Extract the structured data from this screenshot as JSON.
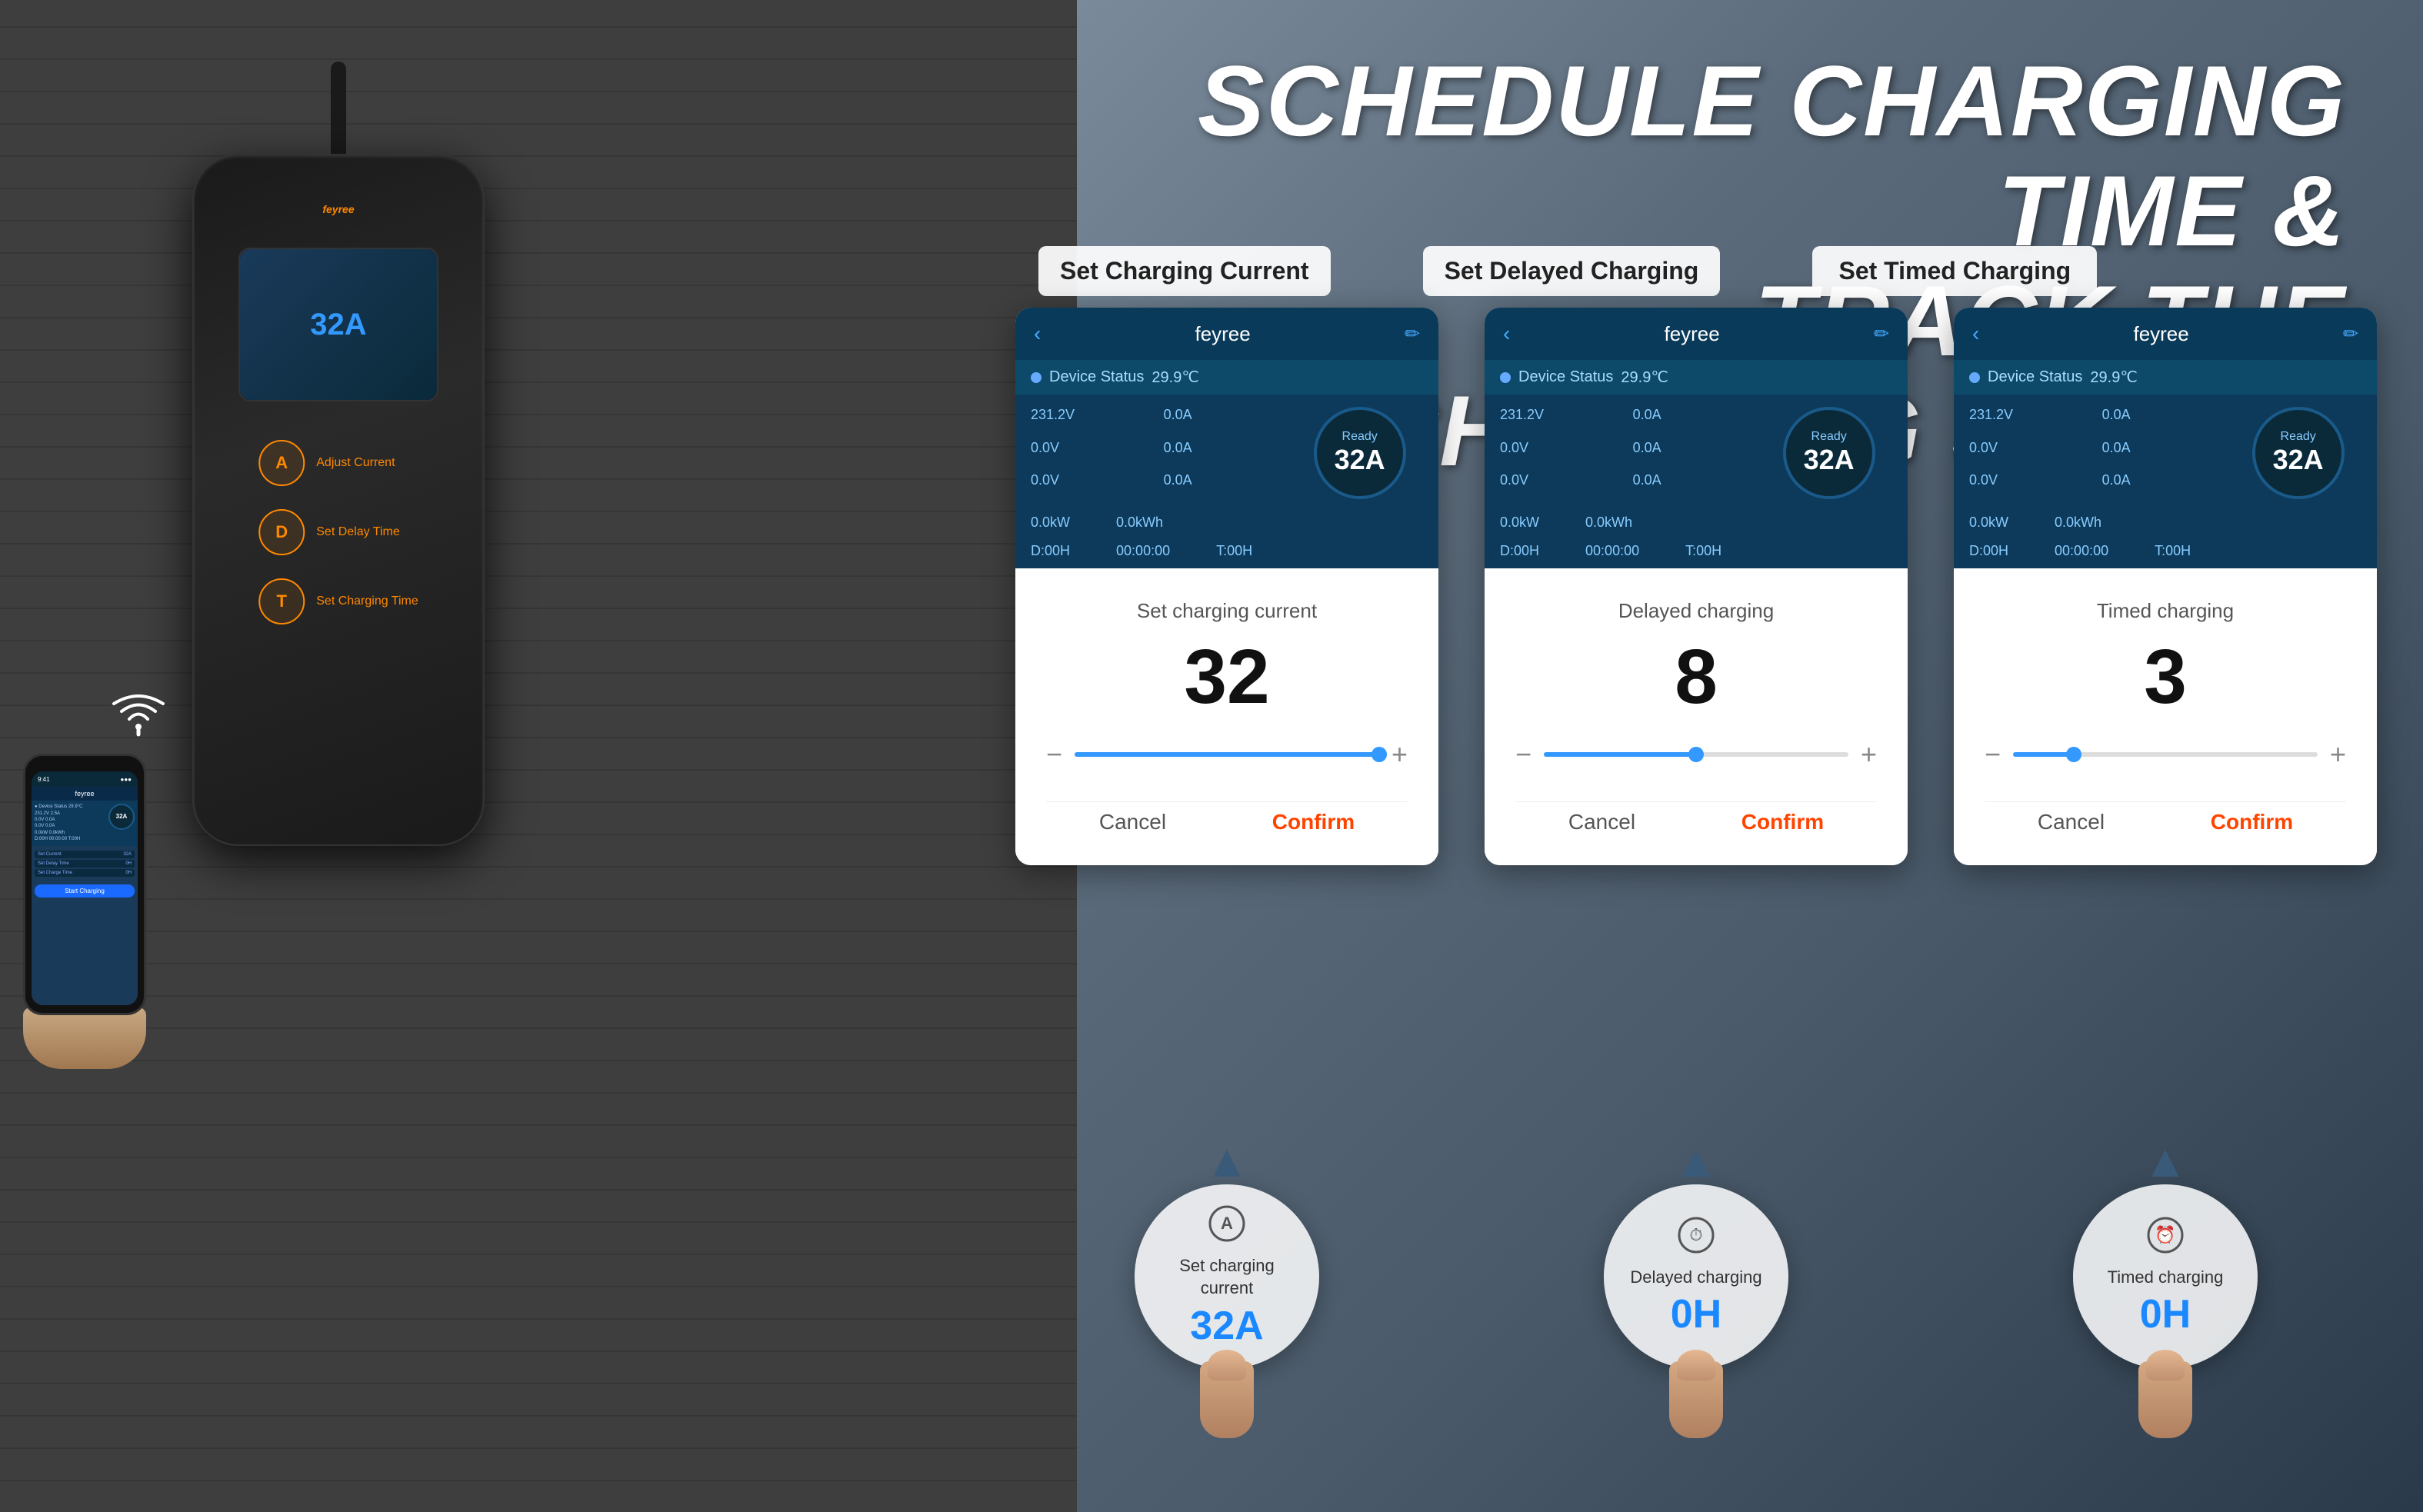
{
  "background": {
    "left_color": "#3a3a3a",
    "right_color": "#5a6a7a"
  },
  "title": {
    "line1": "SCHEDULE CHARGING TIME &",
    "line2": "TRACK THE CHARGING STATUS"
  },
  "sections": [
    {
      "header": "Set Charging Current",
      "app": {
        "app_name": "feyree",
        "device_status_label": "Device Status",
        "device_temp": "29.9℃",
        "metrics": [
          {
            "label": "231.2V",
            "value": "0.0A"
          },
          {
            "label": "0.0V",
            "value": "0.0A"
          },
          {
            "label": "0.0V",
            "value": "0.0A"
          },
          {
            "label": "0.0kW",
            "value": "0.0kWh"
          },
          {
            "label": "D:00H",
            "value": "T:00H"
          }
        ],
        "gauge_status": "Ready",
        "gauge_value": "32A",
        "time": "00:00:00"
      },
      "modal": {
        "title": "Set charging current",
        "value": "32",
        "slider_percent": 100,
        "cancel_label": "Cancel",
        "confirm_label": "Confirm"
      },
      "bottom": {
        "icon_symbol": "A",
        "label": "Set charging\ncurrent",
        "value": "32A"
      }
    },
    {
      "header": "Set Delayed Charging",
      "app": {
        "app_name": "feyree",
        "device_status_label": "Device Status",
        "device_temp": "29.9℃",
        "metrics": [
          {
            "label": "231.2V",
            "value": "0.0A"
          },
          {
            "label": "0.0V",
            "value": "0.0A"
          },
          {
            "label": "0.0V",
            "value": "0.0A"
          },
          {
            "label": "0.0kW",
            "value": "0.0kWh"
          },
          {
            "label": "D:00H",
            "value": "T:00H"
          }
        ],
        "gauge_status": "Ready",
        "gauge_value": "32A",
        "time": "00:00:00"
      },
      "modal": {
        "title": "Delayed charging",
        "value": "8",
        "slider_percent": 50,
        "cancel_label": "Cancel",
        "confirm_label": "Confirm"
      },
      "bottom": {
        "icon_symbol": "⏱",
        "label": "Delayed charging",
        "value": "0H"
      }
    },
    {
      "header": "Set Timed Charging",
      "app": {
        "app_name": "feyree",
        "device_status_label": "Device Status",
        "device_temp": "29.9℃",
        "metrics": [
          {
            "label": "231.2V",
            "value": "0.0A"
          },
          {
            "label": "0.0V",
            "value": "0.0A"
          },
          {
            "label": "0.0V",
            "value": "0.0A"
          },
          {
            "label": "0.0kW",
            "value": "0.0kWh"
          },
          {
            "label": "D:00H",
            "value": "T:00H"
          }
        ],
        "gauge_status": "Ready",
        "gauge_value": "32A",
        "time": "00:00:00"
      },
      "modal": {
        "title": "Timed charging",
        "value": "3",
        "slider_percent": 20,
        "cancel_label": "Cancel",
        "confirm_label": "Confirm"
      },
      "bottom": {
        "icon_symbol": "⏰",
        "label": "Timed charging",
        "value": "0H"
      }
    }
  ],
  "charger": {
    "logo": "feyree",
    "buttons": [
      {
        "letter": "A",
        "label": "Adjust Current"
      },
      {
        "letter": "D",
        "label": "Set Delay Time"
      },
      {
        "letter": "T",
        "label": "Set Charging Time"
      }
    ]
  },
  "phone": {
    "app_name": "feyree",
    "status": "Device Status  29.9°C",
    "metrics_text": "231.2V  2.5A\n0.0V  0.0A\n0.0V  0.0A",
    "gauge": "32A",
    "menu_items": [
      {
        "label": "Set Current",
        "value": "32A"
      },
      {
        "label": "Set Delay Time",
        "value": "0H"
      },
      {
        "label": "Set Charge Time",
        "value": "0H"
      }
    ],
    "start_btn": "Start Charging"
  }
}
